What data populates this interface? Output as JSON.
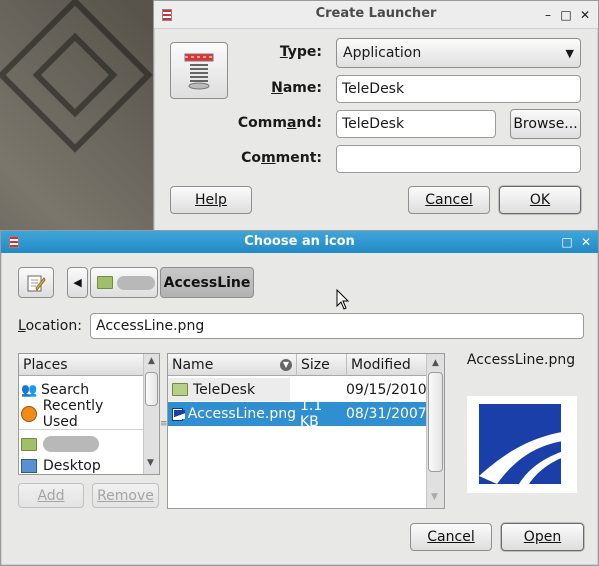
{
  "launcher": {
    "title": "Create Launcher",
    "type_label": "Type:",
    "type_value": "Application",
    "name_label": "Name:",
    "name_value": "TeleDesk",
    "command_label": "Command:",
    "command_value": "TeleDesk",
    "comment_label": "Comment:",
    "comment_value": "",
    "browse_label": "Browse...",
    "help_label": "Help",
    "cancel_label": "Cancel",
    "ok_label": "OK"
  },
  "chooser": {
    "title": "Choose an icon",
    "path_current": "AccessLine",
    "location_label": "Location:",
    "location_value": "AccessLine.png",
    "places_header": "Places",
    "places": [
      {
        "label": "Search",
        "icon": "search-icon"
      },
      {
        "label": "Recently Used",
        "icon": "clock-icon"
      },
      {
        "label": "",
        "icon": "folder-icon"
      },
      {
        "label": "Desktop",
        "icon": "desktop-icon"
      }
    ],
    "add_label": "Add",
    "remove_label": "Remove",
    "columns": {
      "name": "Name",
      "size": "Size",
      "modified": "Modified"
    },
    "files": [
      {
        "name": "TeleDesk",
        "size": "",
        "modified": "09/15/2010",
        "icon": "folder-icon"
      },
      {
        "name": "AccessLine.png",
        "size": "1.1 KB",
        "modified": "08/31/2007",
        "icon": "image-icon"
      }
    ],
    "preview_label": "AccessLine.png",
    "cancel_label": "Cancel",
    "open_label": "Open"
  },
  "colors": {
    "selection": "#2f8fd0",
    "titlebar_active": "#2a93cf",
    "preview_blue": "#1a3fa8"
  }
}
